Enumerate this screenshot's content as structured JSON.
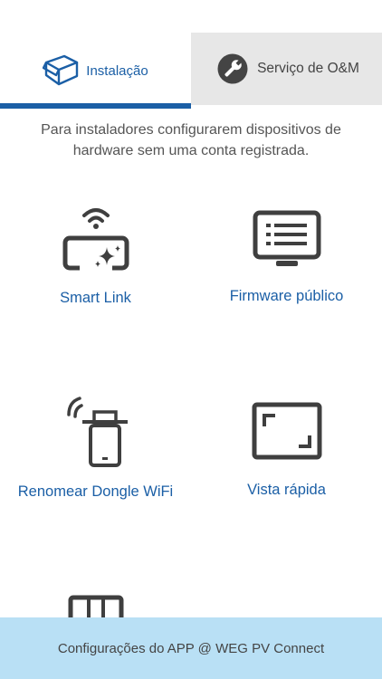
{
  "tabs": {
    "install_label": "Instalação",
    "service_label": "Serviço de O&M"
  },
  "description": "Para instaladores configurarem dispositivos de hardware sem uma conta registrada.",
  "tools": [
    {
      "label": "Smart Link",
      "icon": "smart-link-icon"
    },
    {
      "label": "Firmware público",
      "icon": "monitor-list-icon"
    },
    {
      "label": "Renomear Dongle WiFi",
      "icon": "wifi-dongle-icon"
    },
    {
      "label": "Vista rápida",
      "icon": "quick-view-frame-icon"
    }
  ],
  "footer": {
    "label": "Configurações do APP @ WEG PV Connect"
  },
  "colors": {
    "accent": "#1b5fa6",
    "tab_inactive_bg": "#e7e7e7",
    "footer_bg": "#b9e0f5"
  }
}
